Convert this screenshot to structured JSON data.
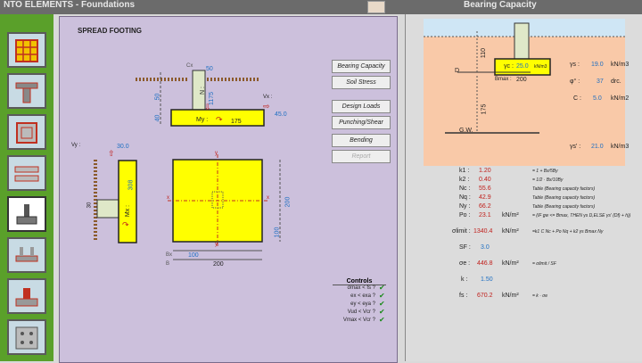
{
  "app": {
    "title_left": "NTO ELEMENTS - Foundations",
    "title_right": "Bearing Capacity"
  },
  "colors": {
    "nav_green": "#5aa02a",
    "sheet_bg": "#ccc0dc",
    "footing": "#ffff00",
    "soil": "#f9c9a8",
    "check": "#1a8a1a"
  },
  "nav": [
    {
      "name": "slab-grid-icon"
    },
    {
      "name": "beam-section-icon"
    },
    {
      "name": "column-section-icon"
    },
    {
      "name": "beam-reinforcement-icon"
    },
    {
      "name": "spread-footing-icon",
      "selected": true
    },
    {
      "name": "strip-footing-icon"
    },
    {
      "name": "combined-footing-icon"
    },
    {
      "name": "pile-cap-icon"
    }
  ],
  "sheet": {
    "title": "SPREAD FOOTING",
    "buttons": [
      {
        "label": "Bearing Capacity",
        "enabled": true
      },
      {
        "label": "Soil Stress",
        "enabled": true
      },
      {
        "label": "Design Loads",
        "enabled": true
      },
      {
        "label": "Punching/Shear",
        "enabled": true
      },
      {
        "label": "Bending",
        "enabled": true
      },
      {
        "label": "Report",
        "enabled": false
      }
    ],
    "elevation_top": {
      "cx": "Cx",
      "col_width": "50",
      "n_label": "N :",
      "n_value": "1175",
      "vx_label": "Vx :",
      "vx_value": "45.0",
      "my_label": "My :",
      "my_value": "175",
      "h1": "50",
      "h2": "40"
    },
    "elevation_side": {
      "vy_label": "Vy :",
      "vy_value": "30.0",
      "mx_label": "Mx :",
      "mx_value": "308",
      "col_depth": "30"
    },
    "plan": {
      "bx_label": "Bx",
      "bx_value": "100",
      "b_label": "B",
      "b_value": "200",
      "by_value": "100",
      "l_value": "200",
      "x_marker": "x",
      "y_marker": "y"
    },
    "controls": {
      "title": "Controls",
      "rows": [
        "σmax < fs ?",
        "ex < exa ?",
        "ey < eya ?",
        "Vud < Vcr ?",
        "Vmax < Vcr ?"
      ]
    }
  },
  "right": {
    "profile": {
      "gamma_label": "γc :",
      "gamma_value": "25.0",
      "gamma_unit": "kN/m3",
      "bmax_label": "Bmax :",
      "bmax_value": "200",
      "d_label": "D",
      "gw_label": "G.W.",
      "dim_top": "110",
      "dim_mid": "175",
      "ys_label": "γs :",
      "ys_value": "19.0",
      "ys_unit": "kN/m3",
      "phi_label": "φ° :",
      "phi_value": "37",
      "phi_unit": "drc.",
      "c_label": "C :",
      "c_value": "5.0",
      "c_unit": "kN/m2",
      "ysp_label": "γs' :",
      "ysp_value": "21.0",
      "ysp_unit": "kN/m3"
    },
    "results": [
      {
        "label": "k1 :",
        "value": "1.20",
        "unit": "",
        "note": "= 1 + Bx/5By",
        "color": "red"
      },
      {
        "label": "k2 :",
        "value": "0.40",
        "unit": "",
        "note": "= 1/2 · Bx/10By",
        "color": "red"
      },
      {
        "label": "Nc :",
        "value": "55.6",
        "unit": "",
        "note": "Table (Bearing capacity factors)",
        "color": "red"
      },
      {
        "label": "Nq :",
        "value": "42.9",
        "unit": "",
        "note": "Table (Bearing capacity factors)",
        "color": "red"
      },
      {
        "label": "Ny :",
        "value": "66.2",
        "unit": "",
        "note": "Table (Bearing capacity factors)",
        "color": "red"
      },
      {
        "label": "Po :",
        "value": "23.1",
        "unit": "kN/m²",
        "note": "= (IF gw <= Bmax, THEN γs D,ELSE γs' (Df) + h))",
        "color": "red"
      }
    ],
    "sigma_limit": {
      "label": "σlimit :",
      "value": "1340.4",
      "unit": "kN/m²",
      "note": "=k1 C Nc + Po Nq + k2 γs Bmax Ny"
    },
    "sf": {
      "label": "SF :",
      "value": "3.0"
    },
    "sigma_e": {
      "label": "σe :",
      "value": "446.8",
      "unit": "kN/m²",
      "note": "= σlimit / SF"
    },
    "k": {
      "label": "k :",
      "value": "1.50"
    },
    "fs": {
      "label": "fs :",
      "value": "670.2",
      "unit": "kN/m²",
      "note": "= k · σe"
    }
  }
}
